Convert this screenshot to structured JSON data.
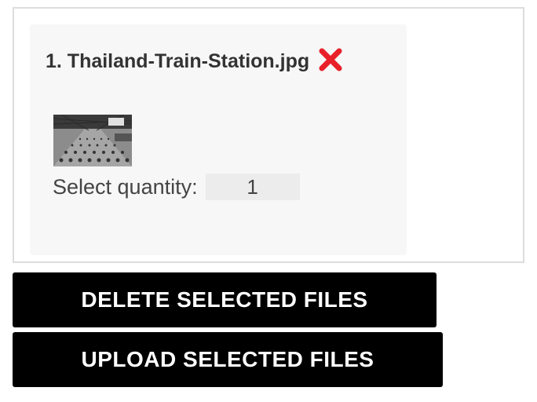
{
  "file_list": {
    "items": [
      {
        "index_title": "1. Thailand-Train-Station.jpg",
        "remove_icon": "red-x-icon",
        "remove_color": "#e8202a",
        "quantity_label": "Select quantity:",
        "quantity_value": "1"
      }
    ]
  },
  "actions": {
    "delete_label": "DELETE SELECTED FILES",
    "upload_label": "UPLOAD SELECTED FILES"
  }
}
